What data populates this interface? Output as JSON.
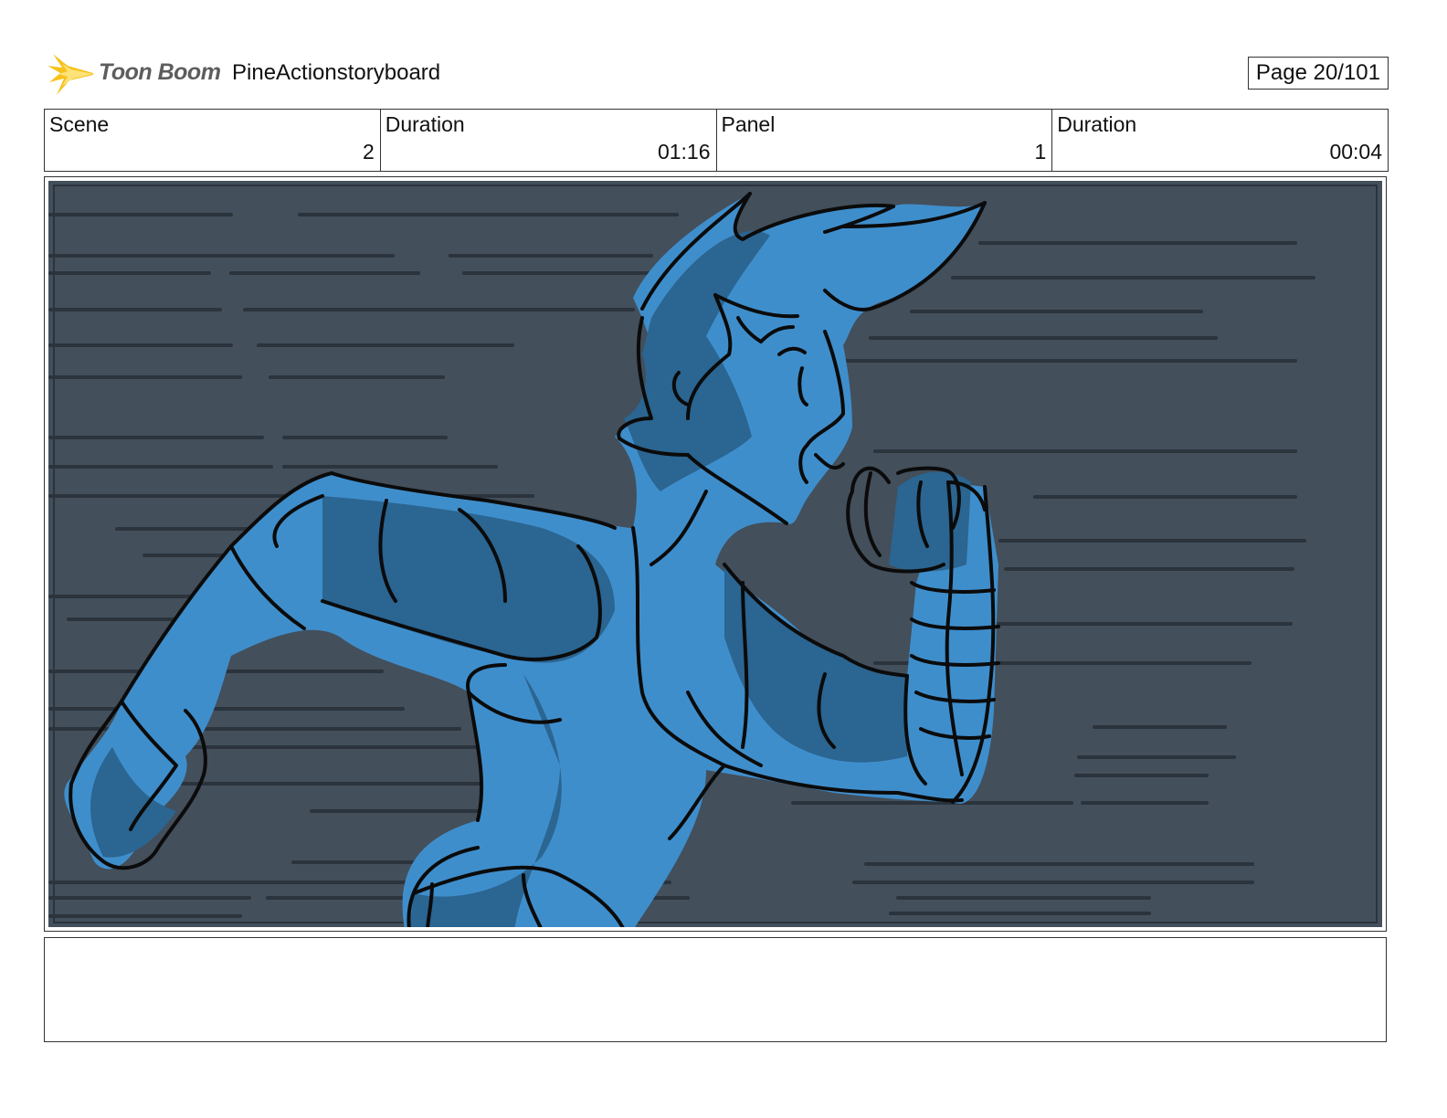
{
  "header": {
    "logo_text": "Toon Boom",
    "project_title": "PineActionstoryboard",
    "page_label": "Page  20/101"
  },
  "info": {
    "cells": [
      {
        "label": "Scene",
        "value": "2"
      },
      {
        "label": "Duration",
        "value": "01:16"
      },
      {
        "label": "Panel",
        "value": "1"
      },
      {
        "label": "Duration",
        "value": "00:04"
      }
    ]
  },
  "panel": {
    "background_color": "#434f5b",
    "speed_line_color": "#2b333c",
    "character_light_color": "#3f8ecc",
    "character_shadow_color": "#2b6591",
    "line_color": "#0b0b0b"
  },
  "notes": {
    "text": ""
  }
}
